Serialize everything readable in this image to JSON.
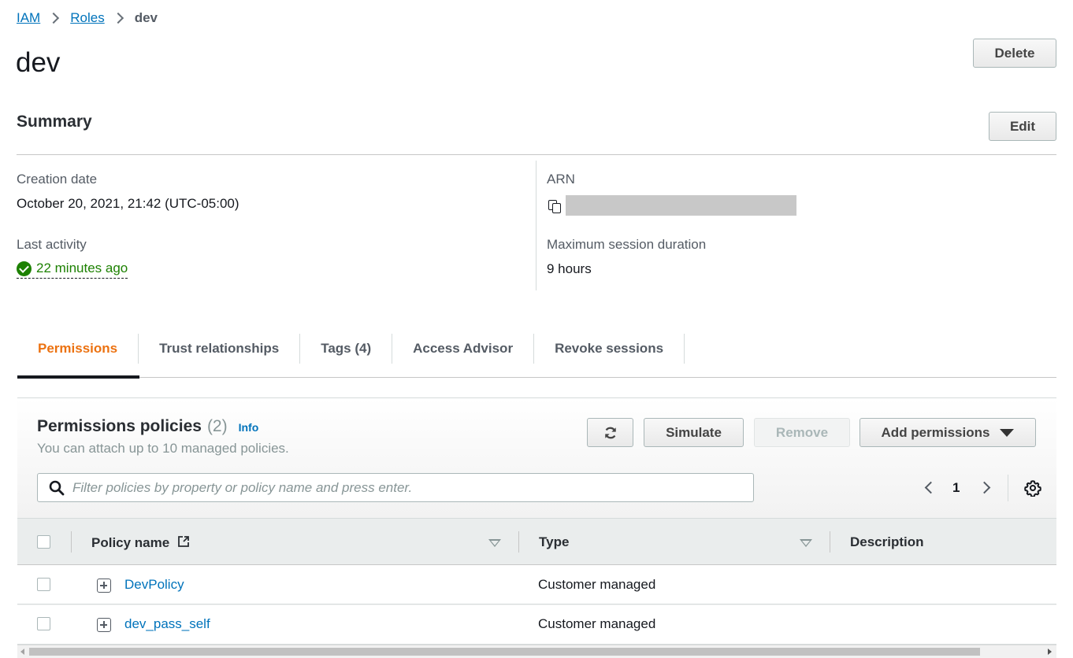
{
  "breadcrumb": [
    {
      "label": "IAM"
    },
    {
      "label": "Roles"
    },
    {
      "label": "dev"
    }
  ],
  "page": {
    "title": "dev",
    "delete_label": "Delete"
  },
  "summary": {
    "title": "Summary",
    "edit_label": "Edit",
    "creation_date_label": "Creation date",
    "creation_date_value": "October 20, 2021, 21:42 (UTC-05:00)",
    "last_activity_label": "Last activity",
    "last_activity_value": "22 minutes ago",
    "arn_label": "ARN",
    "arn_value_redacted": true,
    "max_session_label": "Maximum session duration",
    "max_session_value": "9 hours"
  },
  "tabs": [
    {
      "label": "Permissions",
      "active": true
    },
    {
      "label": "Trust relationships",
      "active": false
    },
    {
      "label": "Tags (4)",
      "active": false
    },
    {
      "label": "Access Advisor",
      "active": false
    },
    {
      "label": "Revoke sessions",
      "active": false
    }
  ],
  "permissions": {
    "title": "Permissions policies",
    "count": "(2)",
    "info_label": "Info",
    "subtitle": "You can attach up to 10 managed policies.",
    "refresh_icon": "refresh-icon",
    "simulate_label": "Simulate",
    "remove_label": "Remove",
    "add_permissions_label": "Add permissions",
    "search_placeholder": "Filter policies by property or policy name and press enter.",
    "search_value": "",
    "page_number": "1",
    "columns": [
      {
        "label": "Policy name"
      },
      {
        "label": "Type"
      },
      {
        "label": "Description"
      }
    ],
    "rows": [
      {
        "name": "DevPolicy",
        "type": "Customer managed",
        "description": ""
      },
      {
        "name": "dev_pass_self",
        "type": "Customer managed",
        "description": ""
      }
    ]
  },
  "colors": {
    "link": "#0073bb",
    "active_tab": "#ec7211",
    "success": "#1d8102"
  }
}
